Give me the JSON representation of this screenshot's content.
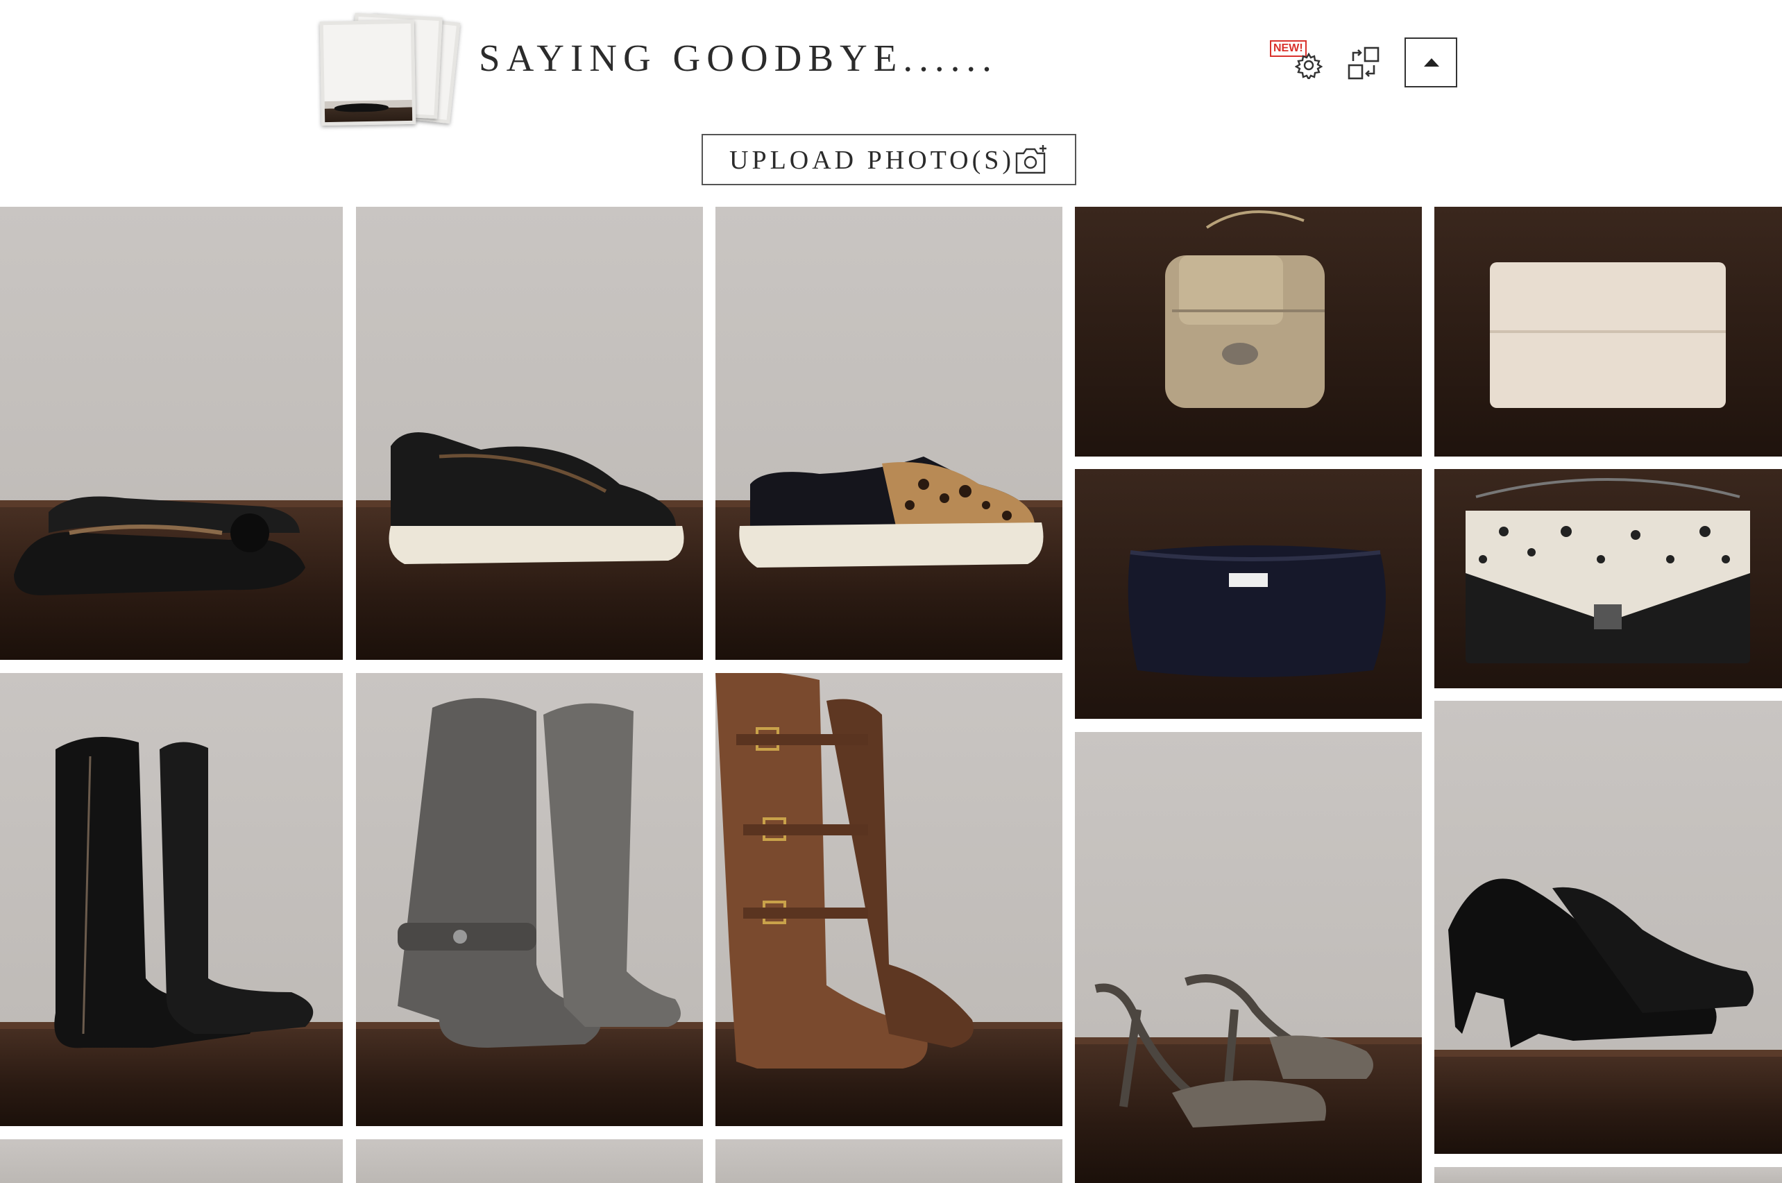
{
  "header": {
    "title": "SAYING GOODBYE......",
    "settings_badge": "NEW!",
    "upload_label": "UPLOAD PHOTO(S)"
  },
  "icons": {
    "album": "album-stack-icon",
    "settings": "gear-icon",
    "swap": "swap-icon",
    "scroll_top": "caret-up-icon",
    "upload": "camera-add-icon"
  },
  "colors": {
    "badge": "#d9322c",
    "text": "#2b2b2b",
    "wall": "#c4c0bc",
    "wood": "#2a1a12"
  },
  "gallery": [
    {
      "subject": "black ballet flats"
    },
    {
      "subject": "black perforated slip-on sneakers"
    },
    {
      "subject": "leopard print slip-on sneakers"
    },
    {
      "subject": "gold leather crossbody bag"
    },
    {
      "subject": "cream clutch wallet"
    },
    {
      "subject": "navy kate spade pouch"
    },
    {
      "subject": "leopard flap chain bag"
    },
    {
      "subject": "black tall zip boots"
    },
    {
      "subject": "grey slouch buckle boots"
    },
    {
      "subject": "brown riding boots with buckles"
    },
    {
      "subject": "pewter strappy heels"
    },
    {
      "subject": "black suede heeled booties"
    }
  ]
}
